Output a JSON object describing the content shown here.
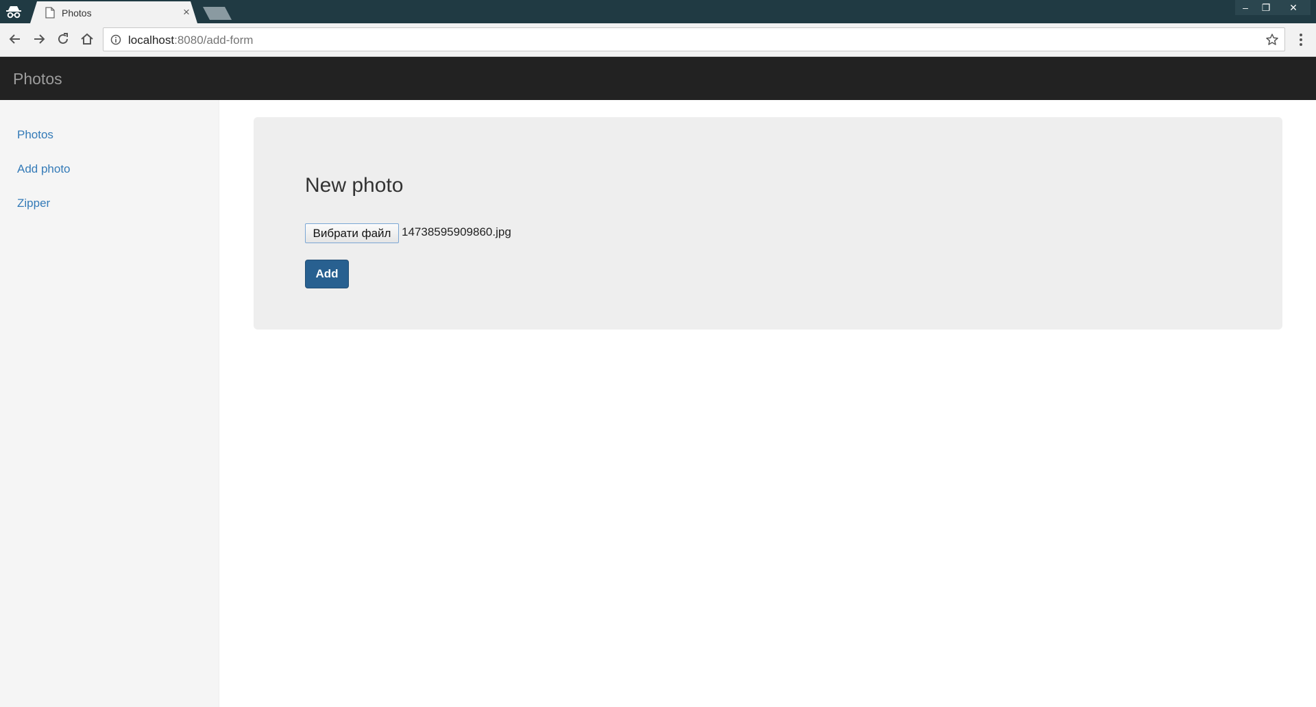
{
  "browser": {
    "tab": {
      "title": "Photos",
      "close_glyph": "×",
      "favicon": "page-icon"
    },
    "window_controls": {
      "minimize": "–",
      "restore": "❐",
      "close": "✕"
    },
    "address": {
      "host": "localhost",
      "rest": ":8080/add-form"
    }
  },
  "app": {
    "brand": "Photos",
    "sidebar": {
      "items": [
        {
          "label": "Photos"
        },
        {
          "label": "Add photo"
        },
        {
          "label": "Zipper"
        }
      ]
    },
    "form": {
      "title": "New photo",
      "file_button_label": "Вибрати файл",
      "file_name": "14738595909860.jpg",
      "submit_label": "Add"
    }
  },
  "colors": {
    "titlebar": "#203a43",
    "navbar": "#222222",
    "link": "#337ab7",
    "primary_button": "#286090",
    "jumbotron": "#eeeeee"
  }
}
